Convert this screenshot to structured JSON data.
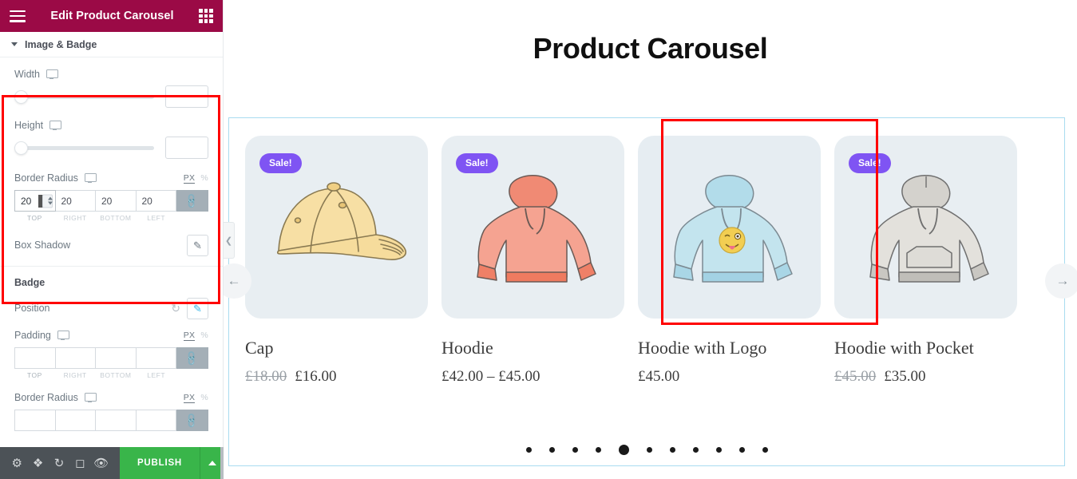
{
  "panel": {
    "header": {
      "title": "Edit Product Carousel",
      "menu_icon": "hamburger-icon",
      "apps_icon": "grid-icon"
    },
    "section": {
      "title": "Image & Badge",
      "toggle_icon": "caret-down-icon"
    },
    "image_group": {
      "width": {
        "label": "Width",
        "device_icon": "monitor-icon",
        "value": ""
      },
      "height": {
        "label": "Height",
        "device_icon": "monitor-icon",
        "value": ""
      },
      "border_radius": {
        "label": "Border Radius",
        "device_icon": "monitor-icon",
        "units": {
          "px": "PX",
          "percent": "%",
          "active": "PX"
        },
        "values": [
          "20",
          "20",
          "20",
          "20"
        ],
        "side_labels": [
          "TOP",
          "RIGHT",
          "BOTTOM",
          "LEFT"
        ],
        "link_icon": "link-icon"
      },
      "box_shadow": {
        "label": "Box Shadow",
        "edit_icon": "pencil-icon"
      }
    },
    "badge_group": {
      "title": "Badge",
      "position": {
        "label": "Position",
        "reset_icon": "reset-icon",
        "edit_icon": "pencil-icon"
      },
      "padding": {
        "label": "Padding",
        "device_icon": "monitor-icon",
        "units": {
          "px": "PX",
          "percent": "%",
          "active": "PX"
        },
        "values": [
          "",
          "",
          "",
          ""
        ],
        "side_labels": [
          "TOP",
          "RIGHT",
          "BOTTOM",
          "LEFT"
        ],
        "link_icon": "link-icon"
      },
      "border_radius": {
        "label": "Border Radius",
        "device_icon": "monitor-icon",
        "units": {
          "px": "PX",
          "percent": "%",
          "active": "PX"
        },
        "values": [
          "",
          "",
          "",
          ""
        ],
        "link_icon": "link-icon"
      }
    },
    "footer": {
      "icons": [
        "gear-icon",
        "layers-icon",
        "history-icon",
        "responsive-icon",
        "preview-icon"
      ],
      "publish_label": "PUBLISH",
      "publish_arrow_icon": "chevron-up-icon",
      "publish_color": "#39b54a"
    },
    "collapse_handle_icon": "chevron-left-icon"
  },
  "canvas": {
    "heading": "Product Carousel",
    "nav": {
      "prev_icon": "arrow-left-icon",
      "next_icon": "arrow-right-icon"
    },
    "products": [
      {
        "name": "Cap",
        "badge": "Sale!",
        "has_badge": true,
        "price_old": "£18.00",
        "price_new": "£16.00",
        "image": "cap-illustration",
        "selected": false
      },
      {
        "name": "Hoodie",
        "badge": "Sale!",
        "has_badge": true,
        "price_old": "",
        "price_new": "£42.00 – £45.00",
        "image": "hoodie-red-illustration",
        "selected": true
      },
      {
        "name": "Hoodie with Logo",
        "badge": "",
        "has_badge": false,
        "price_old": "",
        "price_new": "£45.00",
        "image": "hoodie-blue-logo-illustration",
        "selected": false
      },
      {
        "name": "Hoodie with Pocket",
        "badge": "Sale!",
        "has_badge": true,
        "price_old": "£45.00",
        "price_new": "£35.00",
        "image": "hoodie-gray-pocket-illustration",
        "selected": false
      }
    ],
    "pagination": {
      "count": 11,
      "active_index": 4
    }
  },
  "colors": {
    "header_bg": "#9b0a46",
    "badge_purple": "#7f54f3",
    "publish_green": "#39b54a",
    "card_bg": "#e8eef2",
    "highlight_red": "#ff0000",
    "frame_blue": "#a9dcf0"
  }
}
